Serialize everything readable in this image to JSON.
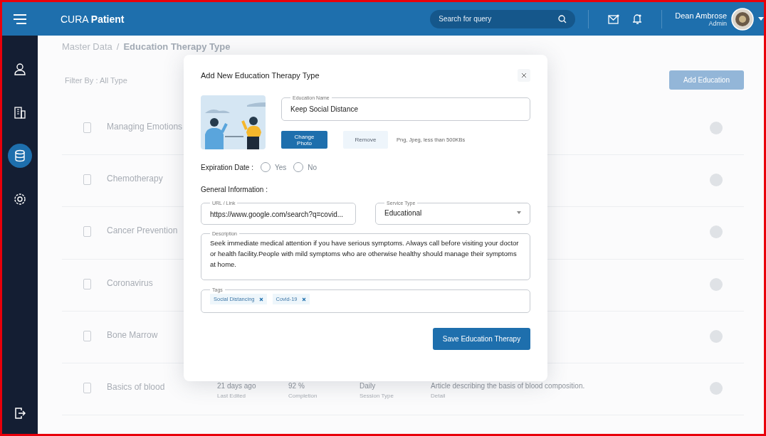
{
  "topbar": {
    "brand_prefix": "CURA",
    "brand_name": "Patient",
    "search": {
      "placeholder": "Search for query"
    },
    "user": {
      "name": "Dean Ambrose",
      "role": "Admin"
    }
  },
  "sidebar": {
    "items": [
      {
        "kind": "user",
        "selected": false
      },
      {
        "kind": "building",
        "selected": false
      },
      {
        "kind": "database",
        "selected": true
      },
      {
        "kind": "settings",
        "selected": false
      }
    ]
  },
  "breadcrumb": {
    "separator": "/",
    "items": [
      {
        "label": "Master Data",
        "current": false
      },
      {
        "label": "Education Therapy Type",
        "current": true
      }
    ]
  },
  "filter": {
    "label": "Filter By : All Type"
  },
  "add_button": "Add Education",
  "rows": [
    {
      "title": "Managing Emotions"
    },
    {
      "title": "Chemotherapy"
    },
    {
      "title": "Cancer Prevention"
    },
    {
      "title": "Coronavirus"
    },
    {
      "title": "Bone Marrow"
    },
    {
      "title": "Basics of blood",
      "stats": [
        {
          "value": "21 days ago",
          "label": "Last Edited"
        },
        {
          "value": "92 %",
          "label": "Completion"
        },
        {
          "value": "Daily",
          "label": "Session Type"
        },
        {
          "value": "Article describing the basis of blood composition.",
          "label": "Detail"
        }
      ]
    }
  ],
  "modal": {
    "title": "Add New Education Therapy Type",
    "name_field": {
      "label": "Education Name",
      "value": "Keep Social Distance"
    },
    "photo_buttons": [
      {
        "label": "Change Photo",
        "kind": "primary"
      },
      {
        "label": "Remove",
        "kind": "secondary"
      }
    ],
    "photo_hint": "Png, Jpeg, less than 500KBs",
    "expiration": {
      "label": "Expiration Date :",
      "options": [
        {
          "label": "Yes",
          "selected": false
        },
        {
          "label": "No",
          "selected": false
        }
      ]
    },
    "section_title": "General Information :",
    "url_field": {
      "label": "URL / Link",
      "value": "https://www.google.com/search?q=covid..."
    },
    "service_type": {
      "label": "Service Type",
      "value": "Educational"
    },
    "description": {
      "label": "Description",
      "value": "Seek immediate medical attention if you have serious symptoms. Always call before visiting your doctor or health facility.People with mild symptoms who are otherwise healthy should manage their symptoms at home."
    },
    "tags": {
      "label": "Tags",
      "items": [
        "Social Distancing",
        "Covid-19"
      ]
    },
    "save_button": "Save Education Therapy"
  }
}
